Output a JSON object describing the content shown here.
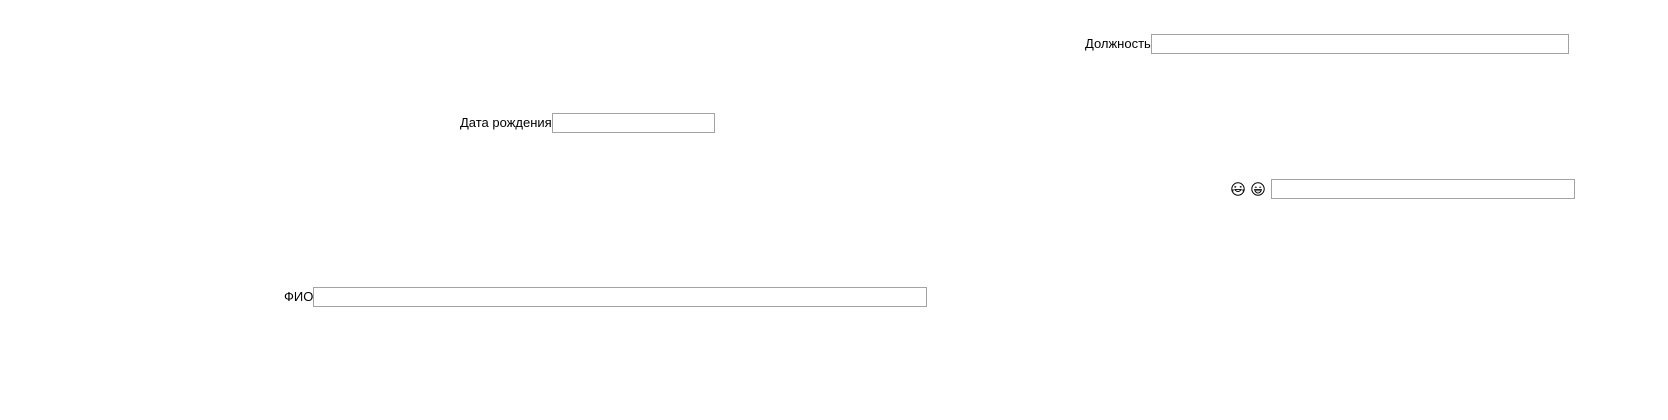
{
  "form": {
    "position": {
      "label": "Должность",
      "value": "",
      "placeholder": ""
    },
    "birthdate": {
      "label": "Дата рождения",
      "value": "",
      "placeholder": ""
    },
    "emoji_field": {
      "icons": [
        "laughing-tears-emoji-icon",
        "grinning-emoji-icon"
      ],
      "value": "",
      "placeholder": ""
    },
    "fio": {
      "label": "ФИО",
      "value": "",
      "placeholder": ""
    }
  }
}
